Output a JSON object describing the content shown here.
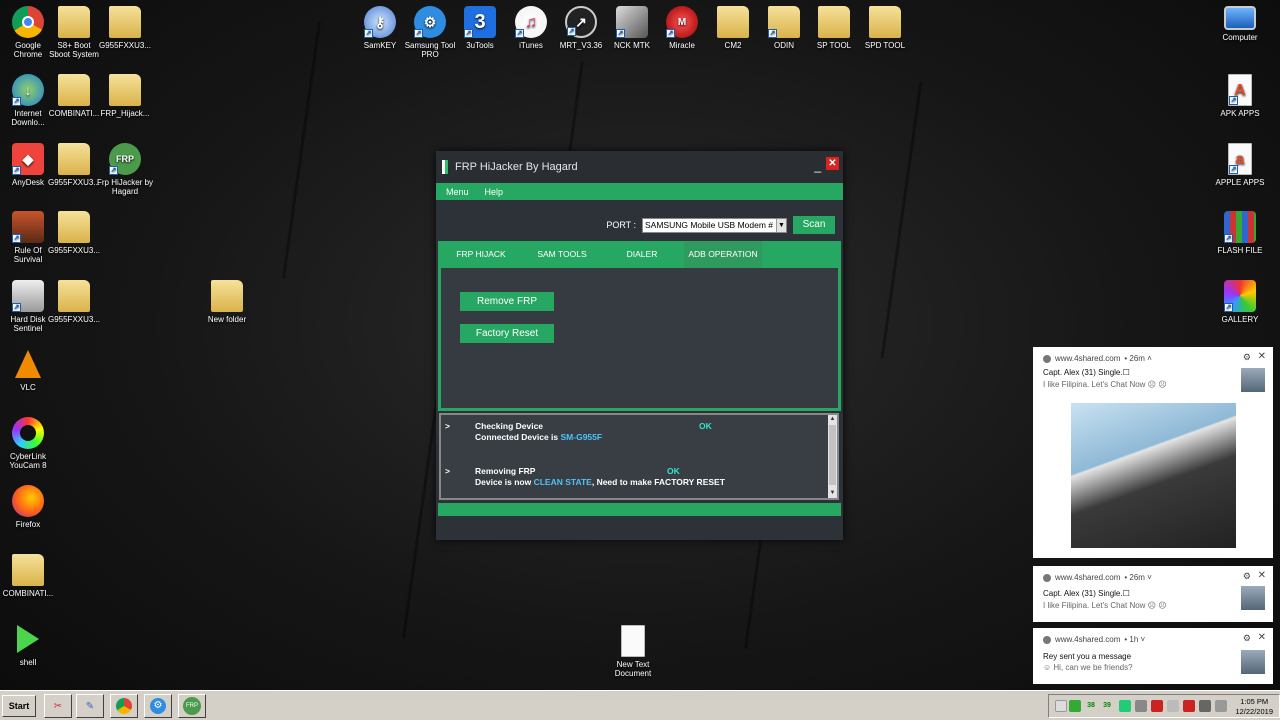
{
  "desktop": {
    "icons": {
      "chrome": "Google Chrome",
      "s8boot": "S8+ Boot Sboot System",
      "g955_1": "G955FXXU3...",
      "idm": "Internet Downlo...",
      "combinati1": "COMBINATI...",
      "frp_hijack": "FRP_Hijack...",
      "anydesk": "AnyDesk",
      "g955_2": "G955FXXU3...",
      "frp_hijacker": "Frp HiJacker by Hagard",
      "ros": "Rule Of Survival",
      "g955_3": "G955FXXU3...",
      "hdsentinel": "Hard Disk Sentinel",
      "g955_4": "G955FXXU3...",
      "new_folder": "New folder",
      "vlc": "VLC",
      "youcam": "CyberLink YouCam 8",
      "firefox": "Firefox",
      "combinati2": "COMBINATI...",
      "shell": "shell",
      "new_text": "New Text Document",
      "samkey": "SamKEY",
      "samsungtool": "Samsung Tool PRO",
      "tools3u": "3uTools",
      "itunes": "iTunes",
      "mrt": "MRT_V3.36",
      "nck": "NCK MTK",
      "miracle": "Miracle",
      "cm2": "CM2",
      "odin": "ODIN",
      "sptool": "SP TOOL",
      "spdtool": "SPD TOOL",
      "computer": "Computer",
      "apkapps": "APK APPS",
      "appleapps": "APPLE APPS",
      "flashfile": "FLASH FILE",
      "gallery": "GALLERY"
    }
  },
  "window": {
    "title": "FRP HiJacker By Hagard",
    "min": "_",
    "close": "✕",
    "menu": [
      "Menu",
      "Help"
    ],
    "port_label": "PORT :",
    "port_value": "SAMSUNG Mobile USB Modem #",
    "scan_label": "Scan",
    "tabs": [
      "FRP HIJACK",
      "SAM TOOLS",
      "DIALER",
      "ADB OPERATION"
    ],
    "buttons": {
      "remove_frp": "Remove FRP",
      "factory_reset": "Factory Reset"
    },
    "log": {
      "l1_prompt": ">",
      "l1_text": "Checking Device",
      "l1_status": "OK",
      "l2_text": "Connected Device is ",
      "l2_model": "SM-G955F",
      "l3_prompt": ">",
      "l3_text": "Removing FRP",
      "l3_status": "OK",
      "l4_text1": "Device is now ",
      "l4_hl": "CLEAN STATE",
      "l4_text2": ", Need to make FACTORY RESET"
    },
    "progress": 1.0
  },
  "notifications": [
    {
      "source": "www.4shared.com",
      "time": "• 26m ˄",
      "title": "Capt. Alex (31) Single.☐",
      "body": "I like Filipina. Let's Chat Now ☹ ☹"
    },
    {
      "source": "www.4shared.com",
      "time": "• 26m ˅",
      "title": "Capt. Alex (31) Single.☐",
      "body": "I like Filipina. Let's Chat Now ☹ ☹"
    },
    {
      "source": "www.4shared.com",
      "time": "• 1h ˅",
      "title": "Rey sent you a message",
      "body": "☺ Hi, can we be friends?"
    }
  ],
  "taskbar": {
    "start": "Start",
    "tray_nums": [
      "38",
      "39"
    ],
    "time": "1:05 PM",
    "date": "12/22/2019"
  },
  "colors": {
    "accent": "#27a862",
    "window_bg": "#2d3238",
    "highlight": "#4fc3f7"
  }
}
